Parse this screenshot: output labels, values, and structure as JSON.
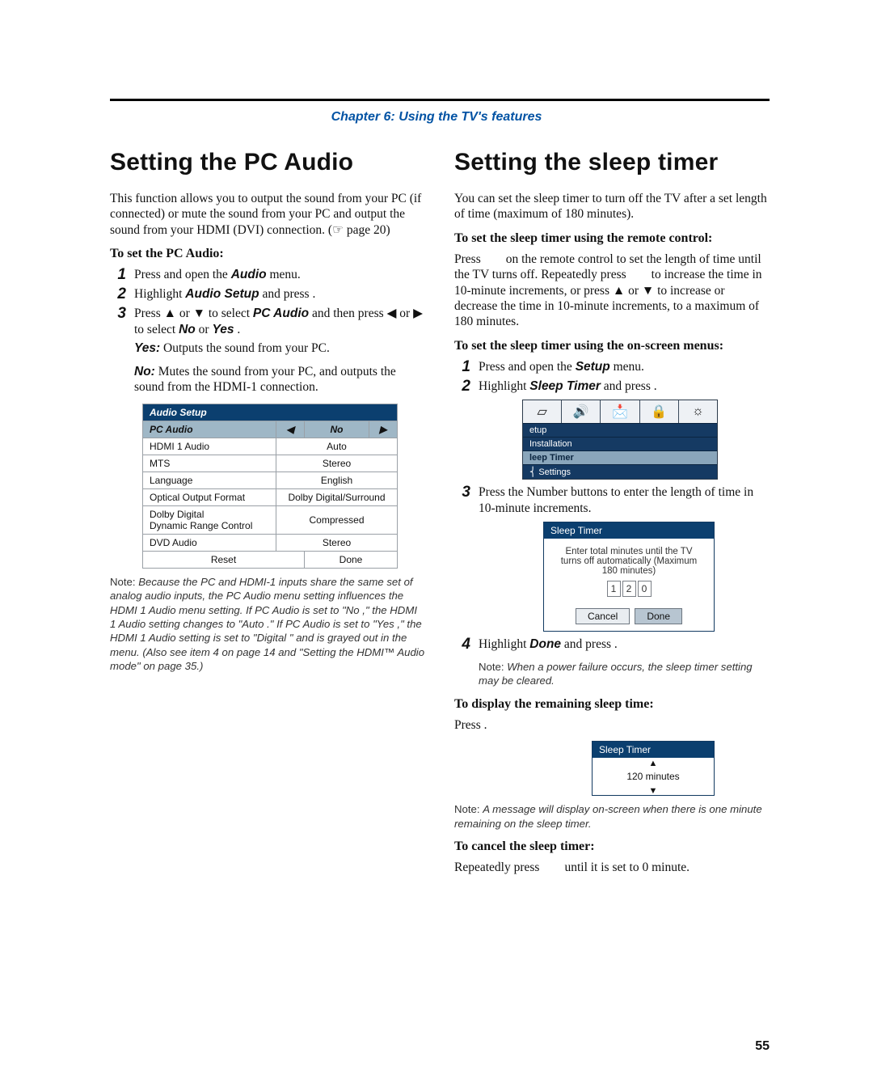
{
  "chapter": "Chapter 6: Using the TV's features",
  "page_number": "55",
  "left": {
    "title": "Setting the PC Audio",
    "intro": "This function allows you to output the sound from your PC (if connected) or mute the sound from your PC and output the sound from your HDMI (DVI) connection. (☞ page 20)",
    "sub": "To set the PC Audio:",
    "steps": {
      "s1_prefix": "Press ",
      "s1_suffix": " and open the ",
      "s1_menu": "Audio",
      "s1_end": " menu.",
      "s2_prefix": "Highlight ",
      "s2_item": "Audio Setup",
      "s2_suffix": " and press ",
      "s2_end": ".",
      "s3a": "Press ▲ or ▼ to select ",
      "s3b": "PC Audio",
      "s3c": " and then press ◀ or ▶ to select ",
      "s3_no": "No",
      "s3_or": " or ",
      "s3_yes": "Yes",
      "s3_end": ".",
      "yes_label": "Yes:",
      "yes_text": " Outputs the sound from your PC.",
      "no_label": "No:",
      "no_text": " Mutes the sound from your PC, and outputs the sound from the HDMI-1 connection."
    },
    "audio_setup": {
      "heading": "Audio Setup",
      "rows": [
        {
          "label": "PC Audio",
          "left_arrow": "◀",
          "value": "No",
          "right_arrow": "▶",
          "selected": true
        },
        {
          "label": "HDMI 1 Audio",
          "value": "Auto"
        },
        {
          "label": "MTS",
          "value": "Stereo"
        },
        {
          "label": "Language",
          "value": "English"
        },
        {
          "label": "Optical Output Format",
          "value": "Dolby Digital/Surround"
        },
        {
          "label": "Dolby Digital\nDynamic Range Control",
          "value": "Compressed"
        },
        {
          "label": "DVD Audio",
          "value": "Stereo"
        }
      ],
      "reset": "Reset",
      "done": "Done"
    },
    "note": {
      "lead": "Note:  ",
      "body": "Because the PC and HDMI-1 inputs share the same set of analog audio inputs, the PC Audio  menu setting influences the HDMI 1 Audio  menu setting. If PC Audio  is set to \"No ,\" the HDMI 1 Audio  setting changes to \"Auto .\" If PC Audio  is set to \"Yes ,\" the HDMI 1 Audio  setting is set to \"Digital \" and is grayed out in the menu. (Also see item 4 on page 14 and \"Setting the HDMI™ Audio mode\" on page 35.)"
    }
  },
  "right": {
    "title": "Setting the sleep timer",
    "intro": "You can set the sleep timer to turn off the TV after a set length of time (maximum of 180 minutes).",
    "sub1": "To set the sleep timer using the remote control:",
    "para1": "Press        on the remote control to set the length of time until the TV turns off. Repeatedly press        to increase the time in 10-minute increments, or press ▲ or ▼ to increase or decrease the time in 10-minute increments, to a maximum of 180 minutes.",
    "sub2": "To set the sleep timer using the on-screen menus:",
    "steps": {
      "s1_prefix": "Press ",
      "s1_suffix": " and open the ",
      "s1_menu": "Setup",
      "s1_end": " menu.",
      "s2_prefix": "Highlight ",
      "s2_item": "Sleep Timer",
      "s2_suffix": " and press ",
      "s2_end": ".",
      "s3": "Press the Number buttons to enter the length of time in 10-minute increments.",
      "s4_prefix": "Highlight ",
      "s4_item": "Done",
      "s4_suffix": " and press ",
      "s4_end": "."
    },
    "setup_box": {
      "icons": [
        "▱",
        "🔊",
        "📩",
        "🔒",
        "☼"
      ],
      "labels": [
        "etup",
        "Installation",
        "leep Timer",
        "Settings"
      ],
      "label_brace": "⎨"
    },
    "sleep_dialog": {
      "title": "Sleep Timer",
      "body1": "Enter total minutes until the TV",
      "body2": "turns off automatically (Maximum",
      "body3": "180 minutes)",
      "d1": "1",
      "d2": "2",
      "d3": "0",
      "cancel": "Cancel",
      "done": "Done"
    },
    "note4": {
      "lead": "Note:  ",
      "body": "When a power failure occurs, the sleep timer setting may be cleared."
    },
    "sub3": "To display the remaining sleep time:",
    "press": "Press ",
    "press_end": ".",
    "sleep_small": {
      "title": "Sleep Timer",
      "up": "▲",
      "value": "120 minutes",
      "down": "▼"
    },
    "note_msg": {
      "lead": "Note:  ",
      "body": "A message will display on-screen when there is one minute remaining on the sleep timer."
    },
    "sub4": "To cancel the sleep timer:",
    "cancel_text": "Repeatedly press        until it is set to 0 minute."
  }
}
